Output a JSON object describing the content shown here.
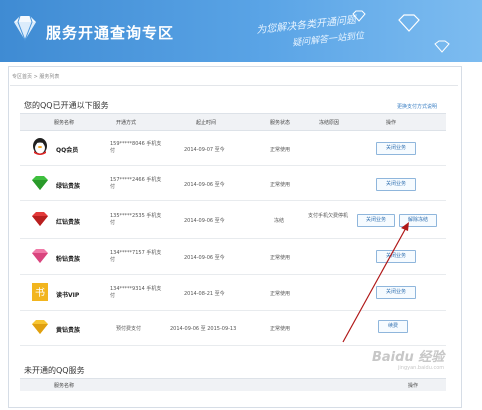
{
  "header": {
    "title": "服务开通查询专区",
    "slogan_line1": "为您解决各类开通问题",
    "slogan_line2": "疑问解答一站到位",
    "accent_color": "#4a96dc"
  },
  "breadcrumb": "专区首页 > 服务列表",
  "opened": {
    "title": "您的QQ已开通以下服务",
    "link": "更换支付方式说明",
    "columns": [
      "服务名称",
      "开通方式",
      "起止时间",
      "服务状态",
      "冻结原因",
      "操作"
    ],
    "rows": [
      {
        "icon": "qq-member-icon",
        "name": "QQ会员",
        "method": "159*****8046 手机支付",
        "time": "2014-09-07 至今",
        "status": "正常使用",
        "reason": "",
        "btn1": "关闭业务",
        "btn2": ""
      },
      {
        "icon": "green-diamond-icon",
        "name": "绿钻贵族",
        "method": "157*****2466 手机支付",
        "time": "2014-09-06 至今",
        "status": "正常使用",
        "reason": "",
        "btn1": "关闭业务",
        "btn2": ""
      },
      {
        "icon": "red-diamond-icon",
        "name": "红钻贵族",
        "method": "135*****2535 手机支付",
        "time": "2014-09-06 至今",
        "status": "冻结",
        "reason": "支付手机欠费停机",
        "btn1": "关闭业务",
        "btn2": "解除冻结"
      },
      {
        "icon": "pink-diamond-icon",
        "name": "粉钻贵族",
        "method": "134*****7157 手机支付",
        "time": "2014-09-06 至今",
        "status": "正常使用",
        "reason": "",
        "btn1": "关闭业务",
        "btn2": ""
      },
      {
        "icon": "book-vip-icon",
        "name": "读书VIP",
        "method": "134*****9314 手机支付",
        "time": "2014-08-21 至今",
        "status": "正常使用",
        "reason": "",
        "btn1": "关闭业务",
        "btn2": ""
      },
      {
        "icon": "yellow-diamond-icon",
        "name": "黄钻贵族",
        "method": "预付费支付",
        "time": "2014-09-06 至 2015-09-13",
        "status": "正常使用",
        "reason": "",
        "btn1": "续费",
        "btn2": ""
      }
    ]
  },
  "unopened": {
    "title": "未开通的QQ服务",
    "columns": [
      "服务名称",
      "操作"
    ]
  },
  "watermark": {
    "brand": "Baidu 经验",
    "url": "jingyan.baidu.com"
  }
}
